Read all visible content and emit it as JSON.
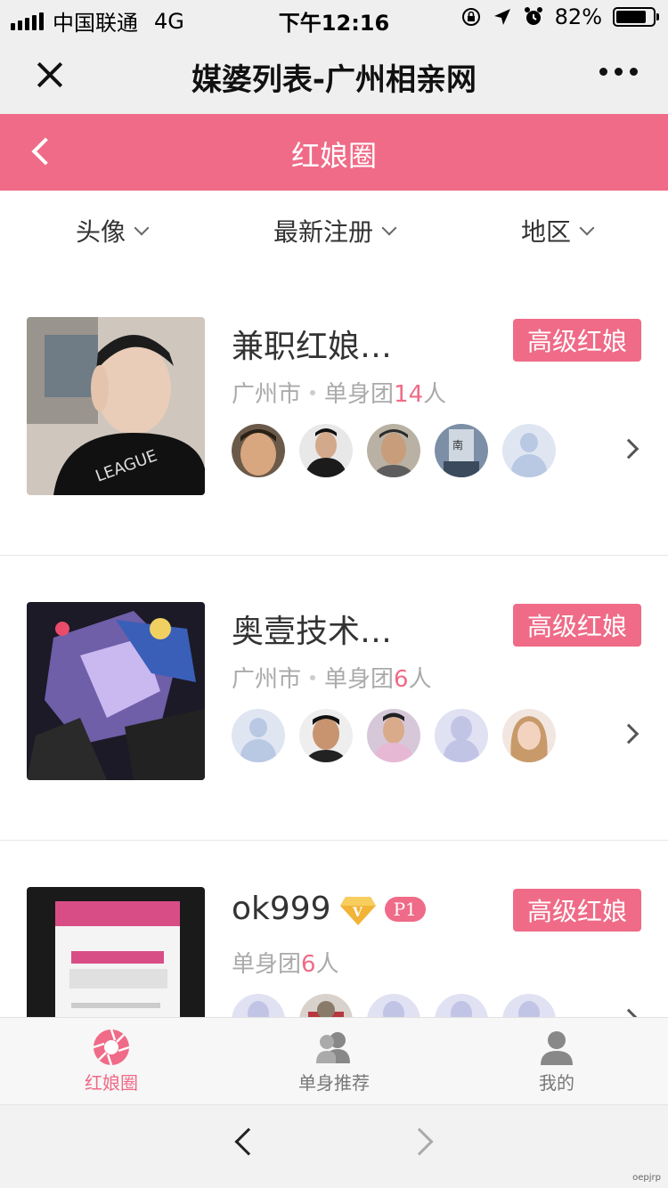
{
  "status_bar": {
    "carrier": "中国联通",
    "network": "4G",
    "time": "下午12:16",
    "battery_percent": "82%",
    "battery_level": 0.82
  },
  "titlebar": {
    "title": "媒婆列表-广州相亲网"
  },
  "header": {
    "title": "红娘圈"
  },
  "filters": [
    {
      "label": "头像"
    },
    {
      "label": "最新注册"
    },
    {
      "label": "地区"
    }
  ],
  "matchmakers": [
    {
      "name": "兼职红娘…",
      "badge": "高级红娘",
      "city": "广州市",
      "group_label": "单身团",
      "group_count": "14",
      "group_unit": "人",
      "avatars": [
        "photo",
        "photo",
        "photo",
        "photo",
        "default"
      ]
    },
    {
      "name": "奥壹技术…",
      "badge": "高级红娘",
      "city": "广州市",
      "group_label": "单身团",
      "group_count": "6",
      "group_unit": "人",
      "avatars": [
        "default",
        "photo",
        "photo",
        "female",
        "photo"
      ]
    },
    {
      "name": "ok999",
      "level": "P1",
      "badge": "高级红娘",
      "group_label": "单身团",
      "group_count": "6",
      "group_unit": "人",
      "avatars": [
        "female",
        "photo",
        "female",
        "female",
        "female"
      ]
    }
  ],
  "tabbar": [
    {
      "label": "红娘圈",
      "icon": "camera-aperture-icon",
      "active": true
    },
    {
      "label": "单身推荐",
      "icon": "users-icon",
      "active": false
    },
    {
      "label": "我的",
      "icon": "user-icon",
      "active": false
    }
  ],
  "watermark": "oepjrp",
  "colors": {
    "accent": "#ef6b87",
    "muted_text": "#aaaaaa"
  }
}
